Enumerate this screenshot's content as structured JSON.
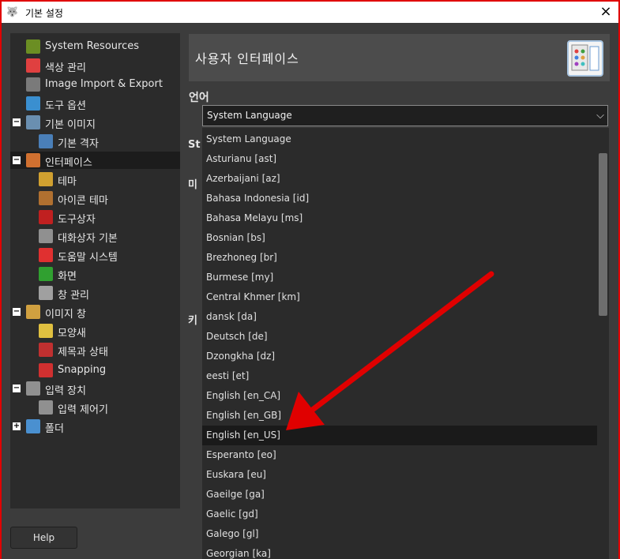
{
  "window": {
    "title": "기본 설정",
    "logo_icon": "gimp-logo-icon",
    "close_icon": "×"
  },
  "sidebar": {
    "items": [
      {
        "label": "System Resources",
        "icon": "chip-icon",
        "color": "#6b8e23"
      },
      {
        "label": "색상 관리",
        "icon": "color-star-icon",
        "color": "#e04040"
      },
      {
        "label": "Image Import & Export",
        "icon": "import-export-icon",
        "color": "#7a7a7a"
      },
      {
        "label": "도구 옵션",
        "icon": "tool-options-icon",
        "color": "#3a8fd0"
      },
      {
        "label": "기본 이미지",
        "icon": "default-image-icon",
        "color": "#6a8fb0",
        "expander": "−"
      },
      {
        "label": "기본 격자",
        "icon": "grid-icon",
        "color": "#4a7fb8"
      },
      {
        "label": "인터페이스",
        "icon": "interface-icon",
        "color": "#d07030",
        "expander": "−",
        "selected": true
      },
      {
        "label": "테마",
        "icon": "theme-icon",
        "color": "#d0a030"
      },
      {
        "label": "아이콘 테마",
        "icon": "icon-theme-icon",
        "color": "#b07030"
      },
      {
        "label": "도구상자",
        "icon": "toolbox-icon",
        "color": "#c02020"
      },
      {
        "label": "대화상자 기본",
        "icon": "dialog-defaults-icon",
        "color": "#909090"
      },
      {
        "label": "도움말 시스템",
        "icon": "help-system-icon",
        "color": "#e03030"
      },
      {
        "label": "화면",
        "icon": "display-icon",
        "color": "#30a030"
      },
      {
        "label": "창 관리",
        "icon": "window-management-icon",
        "color": "#a0a0a0"
      },
      {
        "label": "이미지 창",
        "icon": "image-window-icon",
        "color": "#d0a040",
        "expander": "−"
      },
      {
        "label": "모양새",
        "icon": "appearance-icon",
        "color": "#e0c040"
      },
      {
        "label": "제목과 상태",
        "icon": "title-status-icon",
        "color": "#c03030"
      },
      {
        "label": "Snapping",
        "icon": "snapping-icon",
        "color": "#d03030"
      },
      {
        "label": "입력 장치",
        "icon": "input-devices-icon",
        "color": "#909090",
        "expander": "−"
      },
      {
        "label": "입력 제어기",
        "icon": "input-controllers-icon",
        "color": "#909090"
      },
      {
        "label": "폴더",
        "icon": "folder-icon",
        "color": "#4a90d0",
        "expander": "+"
      }
    ]
  },
  "help_button": {
    "label": "Help"
  },
  "panel": {
    "title": "사용자 인터페이스",
    "icon": "interface-panel-icon",
    "language_label": "언어",
    "hidden_labels": [
      "St",
      "미",
      "키"
    ]
  },
  "language_combo": {
    "value": "System Language",
    "chevron_icon": "chevron-down-icon"
  },
  "language_options": [
    "System Language",
    "Asturianu [ast]",
    "Azerbaijani [az]",
    "Bahasa Indonesia [id]",
    "Bahasa Melayu [ms]",
    "Bosnian [bs]",
    "Brezhoneg [br]",
    "Burmese [my]",
    "Central Khmer [km]",
    "dansk [da]",
    "Deutsch [de]",
    "Dzongkha [dz]",
    "eesti [et]",
    "English [en_CA]",
    "English [en_GB]",
    "English [en_US]",
    "Esperanto [eo]",
    "Euskara [eu]",
    "Gaeilge [ga]",
    "Gaelic [gd]",
    "Galego [gl]",
    "Georgian [ka]"
  ],
  "highlighted_option": "English [en_US]",
  "annotation": {
    "arrow_color": "#e00000",
    "icon": "red-arrow-annotation"
  }
}
